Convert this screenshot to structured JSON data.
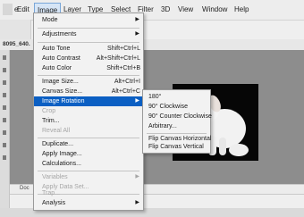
{
  "menubar": {
    "items": [
      "e",
      "Edit",
      "Image",
      "Layer",
      "Type",
      "Select",
      "Filter",
      "3D",
      "View",
      "Window",
      "Help"
    ]
  },
  "document": {
    "tab_name": "8095_640.",
    "status_text": "Doc"
  },
  "image_menu": {
    "items": [
      {
        "label": "Mode",
        "submenu": true
      },
      {
        "label": "Adjustments",
        "submenu": true
      },
      {
        "label": "Auto Tone",
        "shortcut": "Shift+Ctrl+L"
      },
      {
        "label": "Auto Contrast",
        "shortcut": "Alt+Shift+Ctrl+L"
      },
      {
        "label": "Auto Color",
        "shortcut": "Shift+Ctrl+B"
      },
      {
        "label": "Image Size...",
        "shortcut": "Alt+Ctrl+I"
      },
      {
        "label": "Canvas Size...",
        "shortcut": "Alt+Ctrl+C"
      },
      {
        "label": "Image Rotation",
        "submenu": true,
        "highlighted": true
      },
      {
        "label": "Crop",
        "disabled": true
      },
      {
        "label": "Trim..."
      },
      {
        "label": "Reveal All",
        "disabled": true
      },
      {
        "label": "Duplicate..."
      },
      {
        "label": "Apply Image..."
      },
      {
        "label": "Calculations..."
      },
      {
        "label": "Variables",
        "submenu": true,
        "disabled": true
      },
      {
        "label": "Apply Data Set...",
        "disabled": true
      },
      {
        "label": "Trap...",
        "disabled": true
      },
      {
        "label": "Analysis",
        "submenu": true
      }
    ]
  },
  "rotation_menu": {
    "items": [
      "180°",
      "90° Clockwise",
      "90° Counter Clockwise",
      "Arbitrary...",
      "Flip Canvas Horizontal",
      "Flip Canvas Vertical"
    ]
  },
  "colors": {
    "highlight": "#0b5fc3",
    "canvas_bg": "#8d8d8d"
  }
}
